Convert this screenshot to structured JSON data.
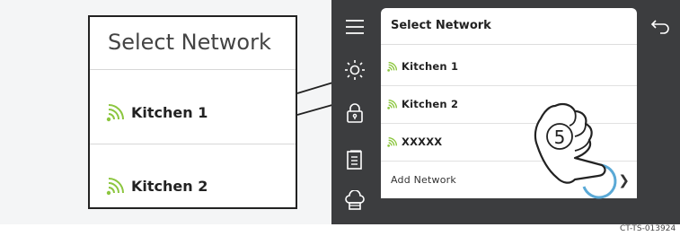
{
  "zoom": {
    "title": "Select Network",
    "items": [
      {
        "label": "Kitchen 1"
      },
      {
        "label": "Kitchen 2"
      }
    ]
  },
  "device": {
    "panel_title": "Select Network",
    "networks": [
      {
        "label": "Kitchen 1",
        "icon": "wifi-icon"
      },
      {
        "label": "Kitchen 2",
        "icon": "wifi-icon"
      },
      {
        "label": "XXXXX",
        "icon": "wifi-icon"
      }
    ],
    "add_network": "Add Network",
    "sidebar_icons": [
      "menu-icon",
      "brightness-icon",
      "lock-icon",
      "recipe-book-icon",
      "chef-hat-icon"
    ]
  },
  "step_number": "5",
  "reference_code": "CT-TS-013924",
  "colors": {
    "wifi": "#8cc63f",
    "device_bg": "#3c3d3f",
    "touch_ring": "#5aa9d6"
  }
}
